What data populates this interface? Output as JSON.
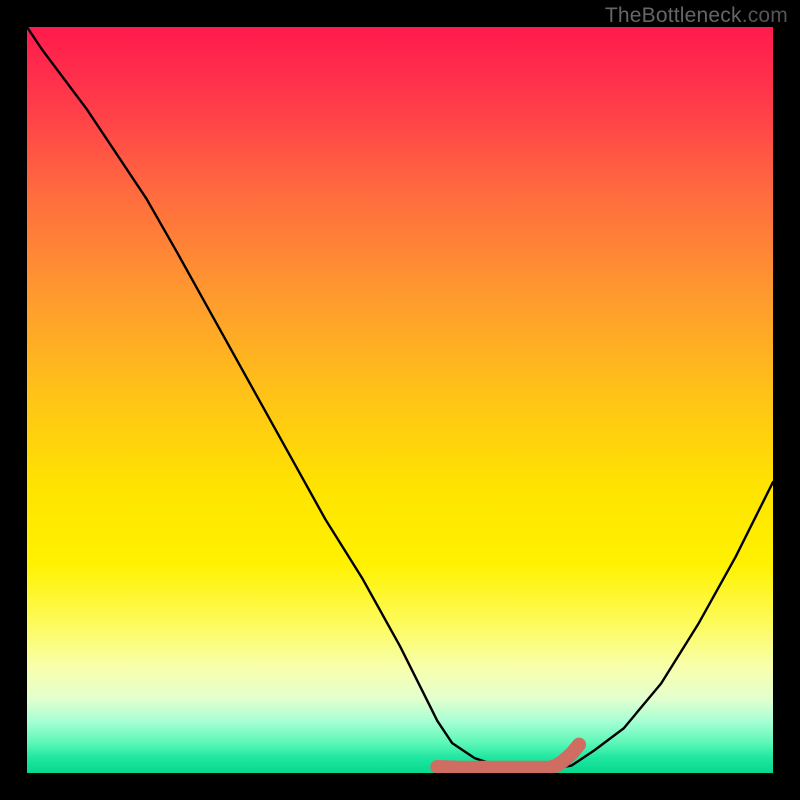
{
  "watermark": {
    "prefix": "TheBottleneck",
    "suffix": ".com"
  },
  "colors": {
    "frame": "#000000",
    "curve": "#000000",
    "highlight": "#cf6d62",
    "gradient_top": "#ff1a4d",
    "gradient_bottom": "#08d88e"
  },
  "chart_data": {
    "type": "line",
    "title": "",
    "xlabel": "",
    "ylabel": "",
    "xlim": [
      0,
      100
    ],
    "ylim": [
      0,
      100
    ],
    "series": [
      {
        "name": "bottleneck-curve",
        "x": [
          0,
          2,
          5,
          8,
          12,
          16,
          20,
          25,
          30,
          35,
          40,
          45,
          50,
          53,
          55,
          57,
          60,
          63,
          66,
          70,
          73,
          76,
          80,
          85,
          90,
          95,
          100
        ],
        "y": [
          100,
          97,
          93,
          89,
          83,
          77,
          70,
          61,
          52,
          43,
          34,
          26,
          17,
          11,
          7,
          4,
          2,
          1,
          0.5,
          0.5,
          1,
          3,
          6,
          12,
          20,
          29,
          39
        ]
      }
    ],
    "highlight_segment": {
      "name": "optimal-range",
      "x": [
        55,
        58,
        61,
        64,
        67,
        70,
        71,
        72,
        73,
        74
      ],
      "y": [
        0.8,
        0.7,
        0.7,
        0.7,
        0.7,
        0.7,
        1.0,
        1.7,
        2.6,
        3.8
      ]
    },
    "background": "vertical rainbow gradient (red top → green bottom)"
  }
}
